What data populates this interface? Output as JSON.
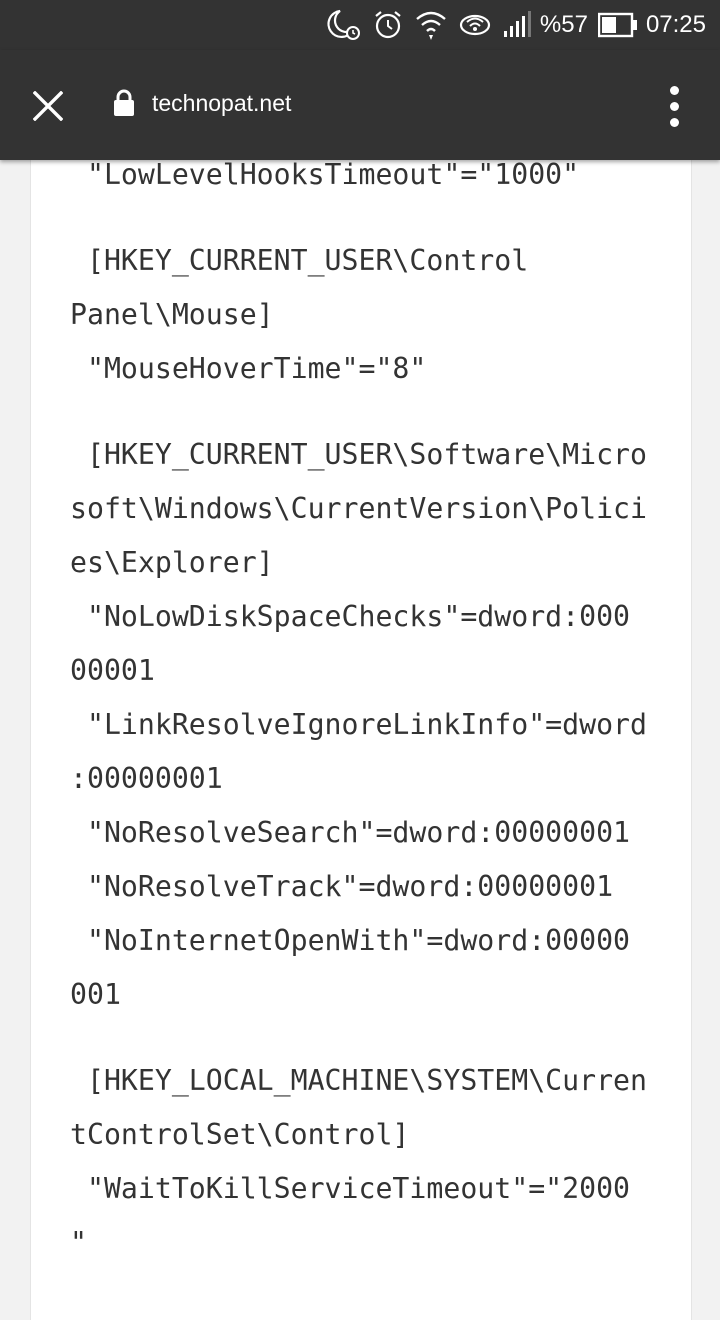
{
  "status_bar": {
    "battery_text": "%57",
    "time": "07:25",
    "icons": [
      "moon-alarm-icon",
      "alarm-clock-icon",
      "wifi-icon",
      "hotspot-icon",
      "signal-icon",
      "battery-icon"
    ]
  },
  "toolbar": {
    "url": "technopat.net",
    "icons": [
      "close-icon",
      "lock-icon",
      "more-vert-icon"
    ]
  },
  "code_lines": [
    " \"LowLevelHooksTimeout\"=\"1000\"",
    " [HKEY_CURRENT_USER\\Control",
    "Panel\\Mouse]",
    " \"MouseHoverTime\"=\"8\"",
    " [HKEY_CURRENT_USER\\Software\\Micro",
    "soft\\Windows\\CurrentVersion\\Polici",
    "es\\Explorer]",
    " \"NoLowDiskSpaceChecks\"=dword:000",
    "00001",
    " \"LinkResolveIgnoreLinkInfo\"=dword",
    ":00000001",
    " \"NoResolveSearch\"=dword:00000001",
    " \"NoResolveTrack\"=dword:00000001",
    " \"NoInternetOpenWith\"=dword:00000",
    "001",
    " [HKEY_LOCAL_MACHINE\\SYSTEM\\Curren",
    "tControlSet\\Control]",
    " \"WaitToKillServiceTimeout\"=\"2000",
    "\""
  ],
  "colors": {
    "toolbar_bg": "#333333",
    "page_bg": "#f2f2f2",
    "card_bg": "#ffffff",
    "code_text": "#333333"
  }
}
